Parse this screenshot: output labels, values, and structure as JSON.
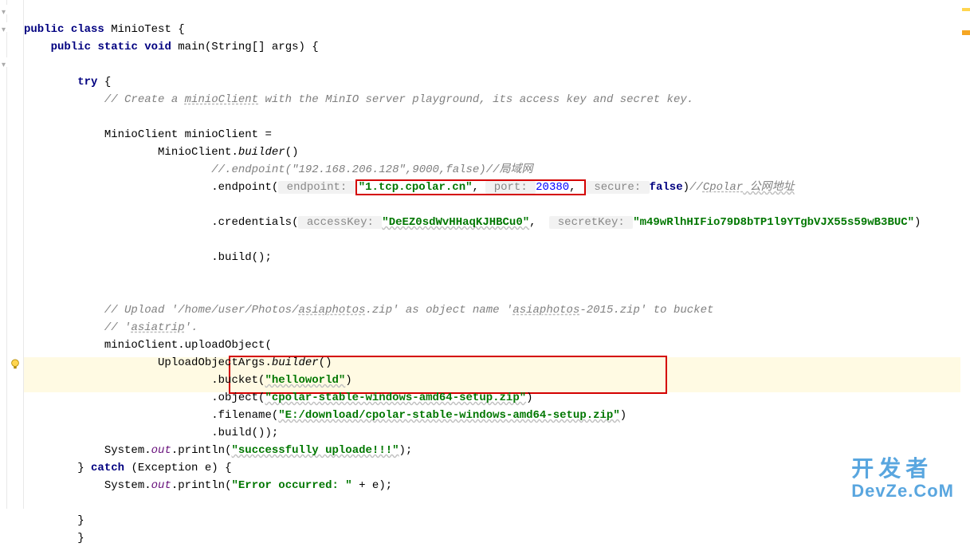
{
  "code": {
    "line1_kw1": "public",
    "line1_kw2": "class",
    "line1_cls": "MinioTest",
    "line1_brace": " {",
    "line2_kw1": "public",
    "line2_kw2": "static",
    "line2_kw3": "void",
    "line2_sig": "main(String[] args) {",
    "line3_kw": "try",
    "line3_brace": " {",
    "comment1": "// Create a ",
    "comment1_u": "minioClient",
    "comment1_b": " with the MinIO server playground, its access key and secret key.",
    "decl1": "MinioClient minioClient =",
    "decl2a": "MinioClient.",
    "decl2b": "builder",
    "decl2c": "()",
    "comment_endpoint": "//.endpoint(\"192.168.206.128\",9000,false)//局域网",
    "endpoint_pre": ".endpoint(",
    "hint_endpoint": " endpoint: ",
    "endpoint_host": "\"1.tcp.cpolar.cn\"",
    "endpoint_comma1": ", ",
    "hint_port": " port: ",
    "endpoint_port": "20380",
    "endpoint_comma2": ", ",
    "hint_secure": " secure: ",
    "endpoint_false": "false",
    "endpoint_close": ")",
    "comment_cpolar_a": "//",
    "comment_cpolar_b": "Cpolar",
    "comment_cpolar_c": " 公网地址",
    "cred_pre": ".credentials(",
    "hint_ak": " accessKey: ",
    "cred_ak": "\"DeEZ0sdWvHHaqKJHBCu0\"",
    "cred_comma": ",  ",
    "hint_sk": " secretKey: ",
    "cred_sk": "\"m49wRlhHIFio79D8bTP1l9YTgbVJX55s59wB3BUC\"",
    "cred_close": ")",
    "build1": ".build();",
    "comment_upload_a": "// Upload '/home/user/Photos/",
    "comment_upload_b": "asiaphotos",
    "comment_upload_c": ".zip' as object name '",
    "comment_upload_d": "asiaphotos",
    "comment_upload_e": "-2015.zip' to bucket",
    "comment_asiatrip_a": "// '",
    "comment_asiatrip_b": "asiatrip",
    "comment_asiatrip_c": "'.",
    "upload_call": "minioClient.uploadObject(",
    "upload_args_a": "UploadObjectArgs.",
    "upload_args_b": "builder",
    "upload_args_c": "()",
    "bucket_pre": ".bucket(",
    "bucket_val": "\"helloworld\"",
    "bucket_close": ")",
    "object_pre": ".object(",
    "object_val": "\"cpolar-stable-windows-amd64-setup.zip\"",
    "object_close": ")",
    "filename_pre": ".filename(",
    "filename_val": "\"E:/download/cpolar-stable-windows-amd64-setup.zip\"",
    "filename_close": ")",
    "build2": ".build());",
    "sysout1_a": "System.",
    "sysout1_b": "out",
    "sysout1_c": ".println(",
    "sysout1_str": "\"successfully uploade!!!\"",
    "sysout1_d": ");",
    "catch_a": "} ",
    "catch_kw": "catch",
    "catch_b": " (Exception e) {",
    "sysout2_a": "System.",
    "sysout2_b": "out",
    "sysout2_c": ".println(",
    "sysout2_str": "\"Error occurred: \"",
    "sysout2_d": " + e);",
    "close1": "}",
    "close2": "}"
  },
  "watermark": {
    "line1": "开发者",
    "line2": "DevZe.CoM"
  }
}
